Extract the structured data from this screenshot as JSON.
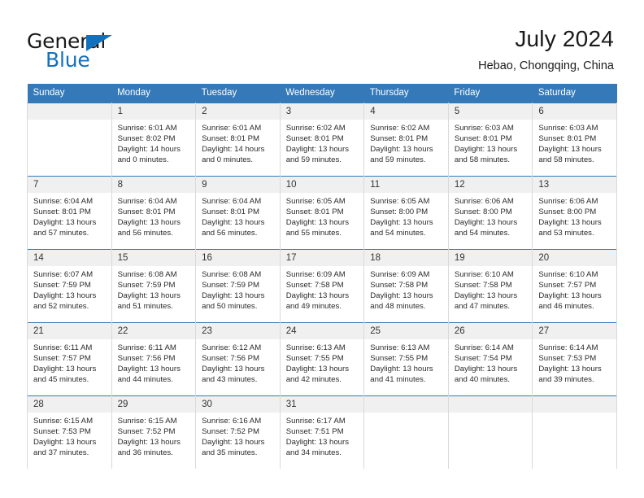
{
  "logo": {
    "word_one": "General",
    "word_two": "Blue",
    "triangle_icon": "triangle-icon",
    "brand_color": "#1271bd"
  },
  "header": {
    "title": "July 2024",
    "location": "Hebao, Chongqing, China"
  },
  "calendar": {
    "header_bg": "#3579b9",
    "daynum_bg": "#f0f0f0",
    "weekdays": [
      "Sunday",
      "Monday",
      "Tuesday",
      "Wednesday",
      "Thursday",
      "Friday",
      "Saturday"
    ],
    "weeks": [
      [
        {
          "day": "",
          "sunrise": "",
          "sunset": "",
          "daylight_a": "",
          "daylight_b": ""
        },
        {
          "day": "1",
          "sunrise": "Sunrise: 6:01 AM",
          "sunset": "Sunset: 8:02 PM",
          "daylight_a": "Daylight: 14 hours",
          "daylight_b": "and 0 minutes."
        },
        {
          "day": "2",
          "sunrise": "Sunrise: 6:01 AM",
          "sunset": "Sunset: 8:01 PM",
          "daylight_a": "Daylight: 14 hours",
          "daylight_b": "and 0 minutes."
        },
        {
          "day": "3",
          "sunrise": "Sunrise: 6:02 AM",
          "sunset": "Sunset: 8:01 PM",
          "daylight_a": "Daylight: 13 hours",
          "daylight_b": "and 59 minutes."
        },
        {
          "day": "4",
          "sunrise": "Sunrise: 6:02 AM",
          "sunset": "Sunset: 8:01 PM",
          "daylight_a": "Daylight: 13 hours",
          "daylight_b": "and 59 minutes."
        },
        {
          "day": "5",
          "sunrise": "Sunrise: 6:03 AM",
          "sunset": "Sunset: 8:01 PM",
          "daylight_a": "Daylight: 13 hours",
          "daylight_b": "and 58 minutes."
        },
        {
          "day": "6",
          "sunrise": "Sunrise: 6:03 AM",
          "sunset": "Sunset: 8:01 PM",
          "daylight_a": "Daylight: 13 hours",
          "daylight_b": "and 58 minutes."
        }
      ],
      [
        {
          "day": "7",
          "sunrise": "Sunrise: 6:04 AM",
          "sunset": "Sunset: 8:01 PM",
          "daylight_a": "Daylight: 13 hours",
          "daylight_b": "and 57 minutes."
        },
        {
          "day": "8",
          "sunrise": "Sunrise: 6:04 AM",
          "sunset": "Sunset: 8:01 PM",
          "daylight_a": "Daylight: 13 hours",
          "daylight_b": "and 56 minutes."
        },
        {
          "day": "9",
          "sunrise": "Sunrise: 6:04 AM",
          "sunset": "Sunset: 8:01 PM",
          "daylight_a": "Daylight: 13 hours",
          "daylight_b": "and 56 minutes."
        },
        {
          "day": "10",
          "sunrise": "Sunrise: 6:05 AM",
          "sunset": "Sunset: 8:01 PM",
          "daylight_a": "Daylight: 13 hours",
          "daylight_b": "and 55 minutes."
        },
        {
          "day": "11",
          "sunrise": "Sunrise: 6:05 AM",
          "sunset": "Sunset: 8:00 PM",
          "daylight_a": "Daylight: 13 hours",
          "daylight_b": "and 54 minutes."
        },
        {
          "day": "12",
          "sunrise": "Sunrise: 6:06 AM",
          "sunset": "Sunset: 8:00 PM",
          "daylight_a": "Daylight: 13 hours",
          "daylight_b": "and 54 minutes."
        },
        {
          "day": "13",
          "sunrise": "Sunrise: 6:06 AM",
          "sunset": "Sunset: 8:00 PM",
          "daylight_a": "Daylight: 13 hours",
          "daylight_b": "and 53 minutes."
        }
      ],
      [
        {
          "day": "14",
          "sunrise": "Sunrise: 6:07 AM",
          "sunset": "Sunset: 7:59 PM",
          "daylight_a": "Daylight: 13 hours",
          "daylight_b": "and 52 minutes."
        },
        {
          "day": "15",
          "sunrise": "Sunrise: 6:08 AM",
          "sunset": "Sunset: 7:59 PM",
          "daylight_a": "Daylight: 13 hours",
          "daylight_b": "and 51 minutes."
        },
        {
          "day": "16",
          "sunrise": "Sunrise: 6:08 AM",
          "sunset": "Sunset: 7:59 PM",
          "daylight_a": "Daylight: 13 hours",
          "daylight_b": "and 50 minutes."
        },
        {
          "day": "17",
          "sunrise": "Sunrise: 6:09 AM",
          "sunset": "Sunset: 7:58 PM",
          "daylight_a": "Daylight: 13 hours",
          "daylight_b": "and 49 minutes."
        },
        {
          "day": "18",
          "sunrise": "Sunrise: 6:09 AM",
          "sunset": "Sunset: 7:58 PM",
          "daylight_a": "Daylight: 13 hours",
          "daylight_b": "and 48 minutes."
        },
        {
          "day": "19",
          "sunrise": "Sunrise: 6:10 AM",
          "sunset": "Sunset: 7:58 PM",
          "daylight_a": "Daylight: 13 hours",
          "daylight_b": "and 47 minutes."
        },
        {
          "day": "20",
          "sunrise": "Sunrise: 6:10 AM",
          "sunset": "Sunset: 7:57 PM",
          "daylight_a": "Daylight: 13 hours",
          "daylight_b": "and 46 minutes."
        }
      ],
      [
        {
          "day": "21",
          "sunrise": "Sunrise: 6:11 AM",
          "sunset": "Sunset: 7:57 PM",
          "daylight_a": "Daylight: 13 hours",
          "daylight_b": "and 45 minutes."
        },
        {
          "day": "22",
          "sunrise": "Sunrise: 6:11 AM",
          "sunset": "Sunset: 7:56 PM",
          "daylight_a": "Daylight: 13 hours",
          "daylight_b": "and 44 minutes."
        },
        {
          "day": "23",
          "sunrise": "Sunrise: 6:12 AM",
          "sunset": "Sunset: 7:56 PM",
          "daylight_a": "Daylight: 13 hours",
          "daylight_b": "and 43 minutes."
        },
        {
          "day": "24",
          "sunrise": "Sunrise: 6:13 AM",
          "sunset": "Sunset: 7:55 PM",
          "daylight_a": "Daylight: 13 hours",
          "daylight_b": "and 42 minutes."
        },
        {
          "day": "25",
          "sunrise": "Sunrise: 6:13 AM",
          "sunset": "Sunset: 7:55 PM",
          "daylight_a": "Daylight: 13 hours",
          "daylight_b": "and 41 minutes."
        },
        {
          "day": "26",
          "sunrise": "Sunrise: 6:14 AM",
          "sunset": "Sunset: 7:54 PM",
          "daylight_a": "Daylight: 13 hours",
          "daylight_b": "and 40 minutes."
        },
        {
          "day": "27",
          "sunrise": "Sunrise: 6:14 AM",
          "sunset": "Sunset: 7:53 PM",
          "daylight_a": "Daylight: 13 hours",
          "daylight_b": "and 39 minutes."
        }
      ],
      [
        {
          "day": "28",
          "sunrise": "Sunrise: 6:15 AM",
          "sunset": "Sunset: 7:53 PM",
          "daylight_a": "Daylight: 13 hours",
          "daylight_b": "and 37 minutes."
        },
        {
          "day": "29",
          "sunrise": "Sunrise: 6:15 AM",
          "sunset": "Sunset: 7:52 PM",
          "daylight_a": "Daylight: 13 hours",
          "daylight_b": "and 36 minutes."
        },
        {
          "day": "30",
          "sunrise": "Sunrise: 6:16 AM",
          "sunset": "Sunset: 7:52 PM",
          "daylight_a": "Daylight: 13 hours",
          "daylight_b": "and 35 minutes."
        },
        {
          "day": "31",
          "sunrise": "Sunrise: 6:17 AM",
          "sunset": "Sunset: 7:51 PM",
          "daylight_a": "Daylight: 13 hours",
          "daylight_b": "and 34 minutes."
        },
        {
          "day": "",
          "sunrise": "",
          "sunset": "",
          "daylight_a": "",
          "daylight_b": ""
        },
        {
          "day": "",
          "sunrise": "",
          "sunset": "",
          "daylight_a": "",
          "daylight_b": ""
        },
        {
          "day": "",
          "sunrise": "",
          "sunset": "",
          "daylight_a": "",
          "daylight_b": ""
        }
      ]
    ]
  }
}
